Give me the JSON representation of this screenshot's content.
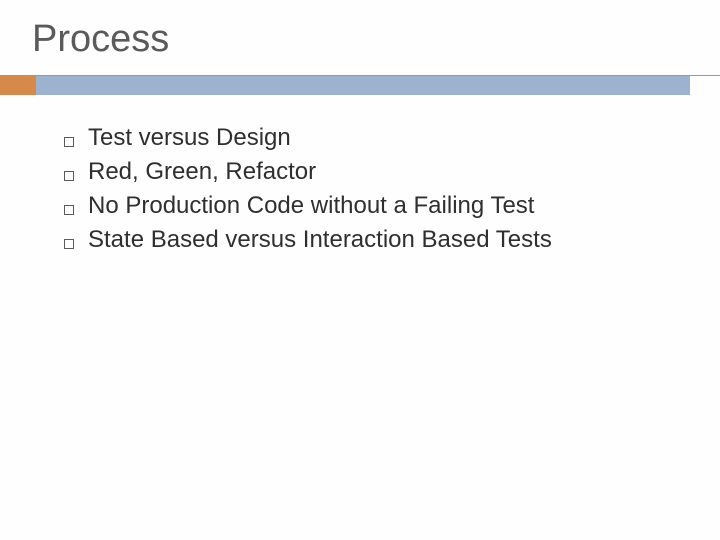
{
  "title": "Process",
  "bullets": [
    "Test versus Design",
    "Red, Green, Refactor",
    "No Production Code without a Failing Test",
    "State Based versus Interaction Based Tests"
  ]
}
